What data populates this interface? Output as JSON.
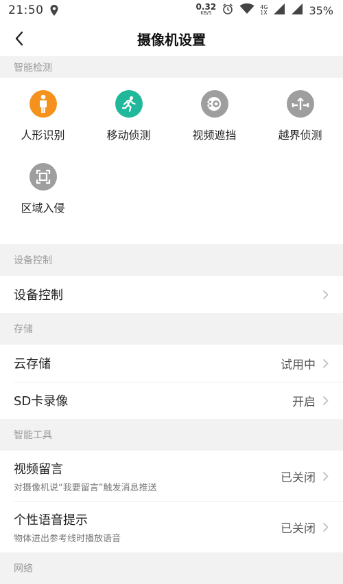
{
  "status_bar": {
    "time": "21:50",
    "speed_value": "0.32",
    "speed_unit": "KB/S",
    "network_top": "4G",
    "network_bottom": "1X",
    "battery": "35%"
  },
  "nav": {
    "title": "摄像机设置"
  },
  "sections": {
    "smart_detection": {
      "header": "智能检测",
      "items": [
        {
          "label": "人形识别",
          "icon": "human-figure-icon",
          "color": "#f5921e"
        },
        {
          "label": "移动侦测",
          "icon": "running-person-icon",
          "color": "#1fb89a"
        },
        {
          "label": "视频遮挡",
          "icon": "video-occlusion-icon",
          "color": "#9e9e9e"
        },
        {
          "label": "越界侦测",
          "icon": "line-crossing-icon",
          "color": "#9e9e9e"
        },
        {
          "label": "区域入侵",
          "icon": "area-intrusion-icon",
          "color": "#9e9e9e"
        }
      ]
    },
    "device_control": {
      "header": "设备控制",
      "row_title": "设备控制"
    },
    "storage": {
      "header": "存储",
      "cloud_title": "云存储",
      "cloud_value": "试用中",
      "sd_title": "SD卡录像",
      "sd_value": "开启"
    },
    "smart_tools": {
      "header": "智能工具",
      "video_msg_title": "视频留言",
      "video_msg_sub": "对摄像机说“我要留言”触发消息推送",
      "video_msg_value": "已关闭",
      "voice_title": "个性语音提示",
      "voice_sub": "物体进出参考线时播放语音",
      "voice_value": "已关闭"
    },
    "network": {
      "header": "网络"
    }
  }
}
